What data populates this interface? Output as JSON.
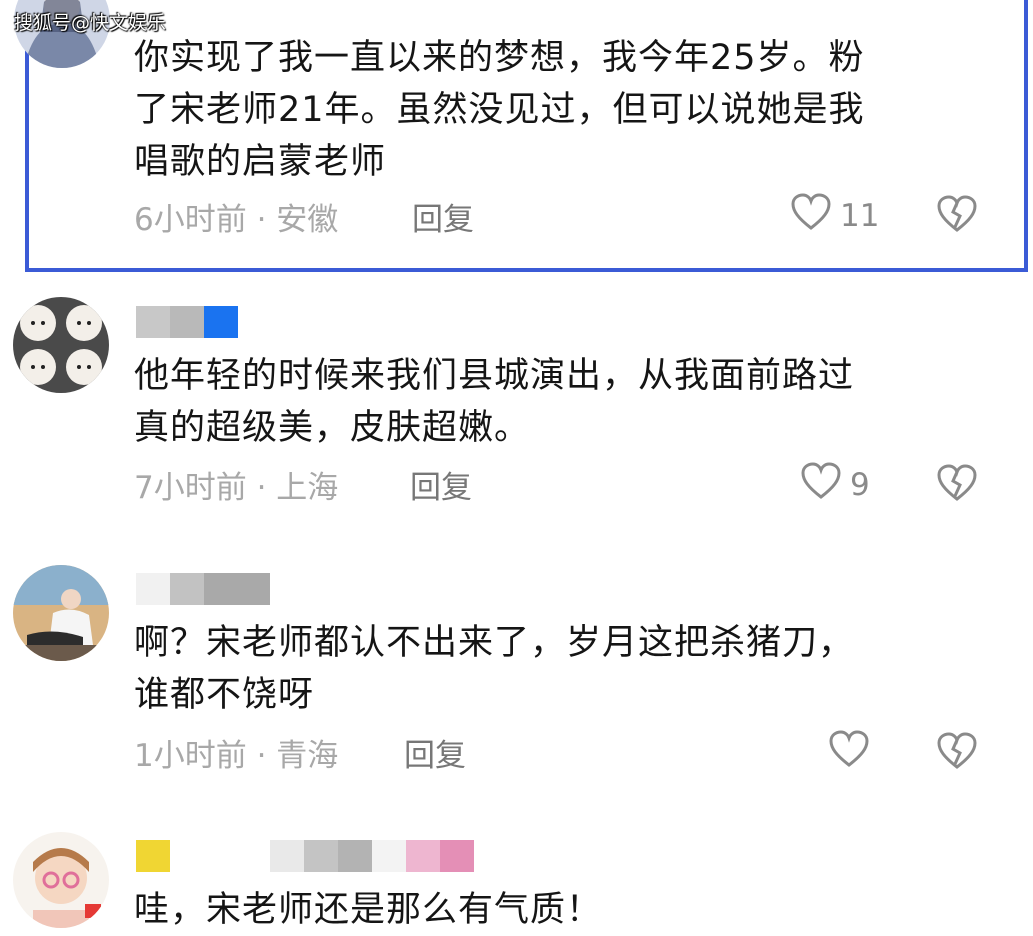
{
  "watermark": "搜狐号@快文娱乐",
  "comments": [
    {
      "text": "你实现了我一直以来的梦想，我今年25岁。粉\n了宋老师21年。虽然没见过，但可以说她是我\n唱歌的启蒙老师",
      "meta": "6小时前 · 安徽",
      "reply": "回复",
      "likes": "11",
      "highlighted": true
    },
    {
      "text": "他年轻的时候来我们县城演出，从我面前路过\n真的超级美，皮肤超嫩。",
      "meta": "7小时前 · 上海",
      "reply": "回复",
      "likes": "9",
      "name_colors": [
        "#c8c8c8",
        "#b9b9b9",
        "#1a73f0"
      ]
    },
    {
      "text": "啊？宋老师都认不出来了，岁月这把杀猪刀，\n谁都不饶呀",
      "meta": "1小时前 · 青海",
      "reply": "回复",
      "likes": "",
      "name_colors": [
        "#f1f1f1",
        "#c2c2c2",
        "#a9a9a9"
      ]
    },
    {
      "text": "哇，宋老师还是那么有气质！",
      "name_colors": [
        "#f0d633",
        "#e9e9e9",
        "#c4c4c4",
        "#b3b3b3",
        "#f3f3f3",
        "#eeb6d0",
        "#e48fb6"
      ]
    }
  ],
  "colors": {
    "highlight_border": "#3b5bd6",
    "meta_text": "#a8a8a8",
    "icon_gray": "#8a8a8a"
  },
  "icons": [
    "heart-outline-icon",
    "broken-heart-icon"
  ]
}
